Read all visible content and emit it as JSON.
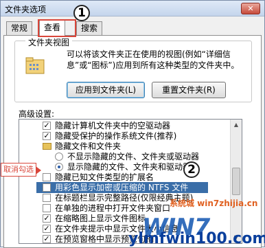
{
  "window": {
    "title": "文件夹选项",
    "close_glyph": "✕"
  },
  "tabs": [
    {
      "label": "常规"
    },
    {
      "label": "查看"
    },
    {
      "label": "搜索"
    }
  ],
  "annotations": {
    "step1": "1",
    "step2": "2",
    "callout": "取消勾选"
  },
  "folder_view": {
    "title": "文件夹视图",
    "description": "可以将该文件夹正在使用的视图(例如“详细信息”或“图标”)应用到所有这种类型的文件夹中。",
    "apply_button": "应用到文件夹(L)",
    "reset_button": "重置文件夹(R)"
  },
  "advanced": {
    "label": "高级设置:",
    "items": [
      {
        "label": "隐藏计算机文件夹中的空驱动器",
        "checked": true
      },
      {
        "label": "隐藏受保护的操作系统文件(推荐)",
        "checked": true
      },
      {
        "label": "隐藏文件和文件夹"
      },
      {
        "label": "不显示隐藏的文件、文件夹或驱动器",
        "selected": false
      },
      {
        "label": "显示隐藏的文件、文件夹和驱动器",
        "selected": true
      },
      {
        "label": "隐藏已知文件类型的扩展名",
        "checked": false
      },
      {
        "label": "用彩色显示加密或压缩的 NTFS 文件",
        "checked": false
      },
      {
        "label": "在标题栏显示完整路径(仅限经典主题)",
        "checked": false
      },
      {
        "label": "在单独的进程中打开文件夹窗口",
        "checked": false
      },
      {
        "label": "在缩略图上显示文件图标",
        "checked": true
      },
      {
        "label": "在文件夹提示中显示文件大小信息",
        "checked": true
      },
      {
        "label": "在预览窗格中显示预览句柄",
        "checked": true
      }
    ],
    "check_glyph": "✓"
  },
  "watermark": {
    "text": "系统城 win7zhijia.cn",
    "logo": "WIN7",
    "site": "ylmfwin100.com"
  }
}
